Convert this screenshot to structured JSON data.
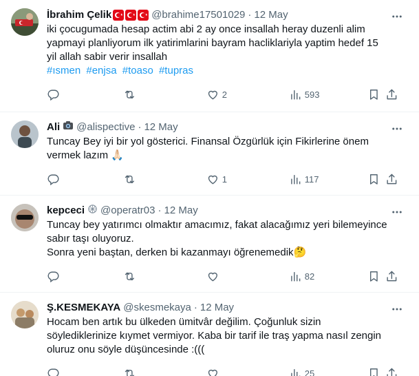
{
  "tweets": [
    {
      "name": "İbrahim Çelik",
      "handle": "@brahime17501029",
      "sep": "·",
      "date": "12 May",
      "lines": [
        "iki çocugumada hesap actim abi 2 ay once insallah heray duzenli alim yapmayi planliyorum ilk yatirimlarini bayram hacliklariyla yaptim hedef 15 yil allah sabir verir insallah"
      ],
      "hashtags": [
        "#ısmen",
        "#enjsa",
        "#toaso",
        "#tupras"
      ],
      "replies": "",
      "retweets": "",
      "likes": "2",
      "views": "593"
    },
    {
      "name": "Ali",
      "handle": "@alispective",
      "sep": "·",
      "date": "12 May",
      "lines": [
        "Tuncay Bey iyi bir yol gösterici. Finansal Özgürlük için Fikirlerine önem vermek lazım 🙏🏻"
      ],
      "replies": "",
      "retweets": "",
      "likes": "1",
      "views": "117"
    },
    {
      "name": "kepceci",
      "handle": "@operatr03",
      "sep": "·",
      "date": "12 May",
      "lines": [
        "Tuncay bey yatırımcı olmaktır amacımız, fakat alacağımız yeri bilemeyince sabır taşı oluyoruz.",
        "Sonra yeni baştan, derken bi kazanmayı öğrenemedik🤔"
      ],
      "replies": "",
      "retweets": "",
      "likes": "",
      "views": "82"
    },
    {
      "name": "Ş.KESMEKAYA",
      "handle": "@skesmekaya",
      "sep": "·",
      "date": "12 May",
      "lines": [
        "Hocam ben artık bu ülkeden ümitvâr değilim.  Çoğunluk  sizin söylediklerinize kıymet vermiyor. Kaba bir tarif ile traş yapma nasıl zengin oluruz onu söyle düşüncesinde :((("
      ],
      "replies": "",
      "retweets": "",
      "likes": "",
      "views": "25"
    }
  ],
  "icons": {
    "more": "more-horizontal-icon",
    "reply": "reply-icon",
    "retweet": "retweet-icon",
    "like": "heart-icon",
    "views": "views-icon",
    "bookmark": "bookmark-icon",
    "share": "share-icon"
  },
  "colors": {
    "text": "#0f1419",
    "secondary": "#536471",
    "link": "#1d9bf0",
    "divider": "#eff3f4"
  }
}
